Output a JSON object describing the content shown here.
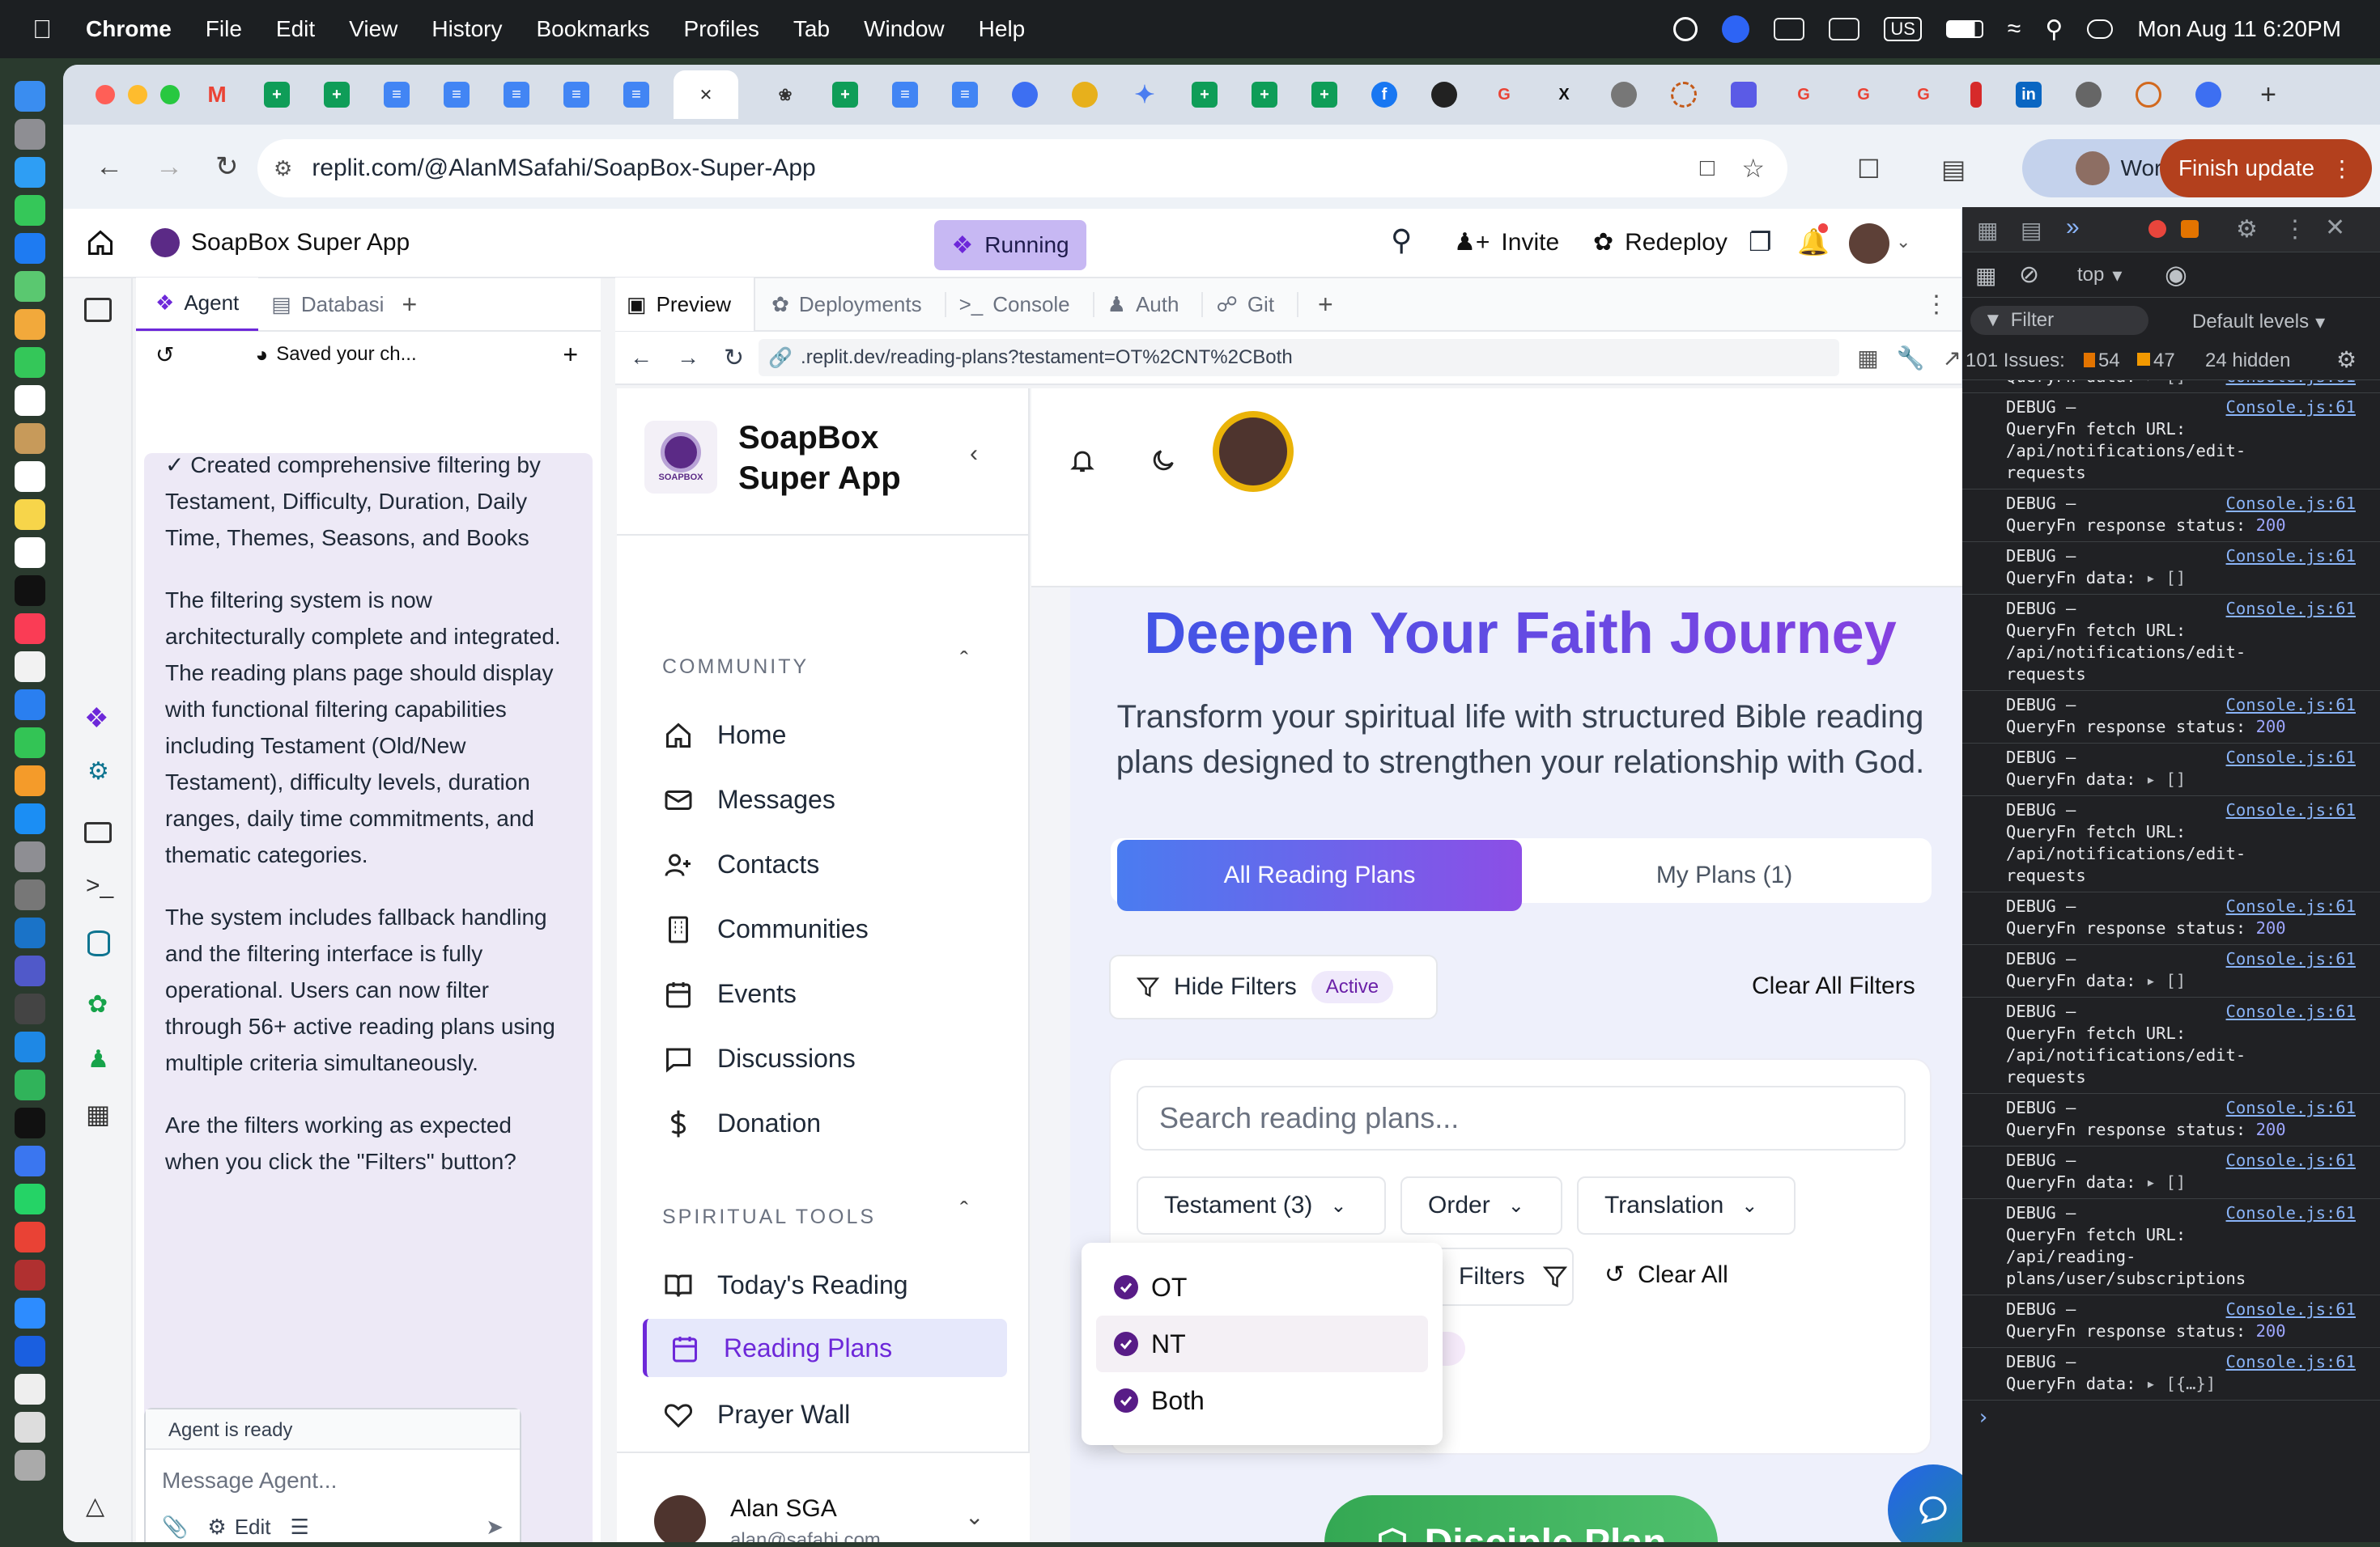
{
  "menubar": {
    "app": "Chrome",
    "items": [
      "File",
      "Edit",
      "View",
      "History",
      "Bookmarks",
      "Profiles",
      "Tab",
      "Window",
      "Help"
    ],
    "clock": "Mon Aug 11  6:20PM",
    "input_source": "US"
  },
  "browser": {
    "url": "replit.com/@AlanMSafahi/SoapBox-Super-App",
    "profile_label": "Work",
    "update_label": "Finish update",
    "tab_icons": [
      "gmail-icon",
      "sheets-icon",
      "sheets-icon",
      "docs-icon",
      "docs-icon",
      "docs-icon",
      "docs-icon",
      "docs-icon",
      "active-tab-close",
      "openai-icon",
      "sheets-icon",
      "docs-icon",
      "docs-icon",
      "app-icon",
      "app-icon",
      "gemini-icon",
      "sheets-icon",
      "sheets-icon",
      "sheets-icon",
      "facebook-icon",
      "github-icon",
      "google-icon",
      "x-icon",
      "app-icon",
      "app-icon",
      "app-icon",
      "google-icon",
      "google-icon",
      "google-icon",
      "app-icon",
      "linkedin-icon",
      "app-icon",
      "app-icon",
      "app-icon"
    ]
  },
  "replit": {
    "project_name": "SoapBox Super App",
    "status": "Running",
    "invite": "Invite",
    "redeploy": "Redeploy",
    "agent_tab": "Agent",
    "database_tab": "Databasi",
    "agent_toolbar_label": "Saved your ch...",
    "agent_messages": [
      "✓ Created comprehensive filtering by Testament, Difficulty, Duration, Daily Time, Themes, Seasons, and Books",
      "The filtering system is now architecturally complete and integrated. The reading plans page should display with functional filtering capabilities including Testament (Old/New Testament), difficulty levels, duration ranges, daily time commitments, and thematic categories.",
      "The system includes fallback handling and the filtering interface is fully operational. Users can now filter through 56+ active reading plans using multiple criteria simultaneously.",
      "Are the filters working as expected when you click the \"Filters\" button?"
    ],
    "agent_status": "Agent is ready",
    "message_placeholder": "Message Agent...",
    "edit_label": "Edit",
    "preview_tabs": [
      "Preview",
      "Deployments",
      "Console",
      "Auth",
      "Git"
    ],
    "preview_url": ".replit.dev/reading-plans?testament=OT%2CNT%2CBoth"
  },
  "app": {
    "brand": "SoapBox Super App",
    "brand_line1": "SoapBox",
    "brand_line2": "Super App",
    "logo_text": "SOAPBOX",
    "community_heading": "COMMUNITY",
    "community_items": [
      "Home",
      "Messages",
      "Contacts",
      "Communities",
      "Events",
      "Discussions",
      "Donation"
    ],
    "tools_heading": "SPIRITUAL TOOLS",
    "tools_items": [
      "Today's Reading",
      "Reading Plans",
      "Prayer Wall"
    ],
    "user_name": "Alan SGA",
    "user_email": "alan@safahi.com",
    "hero_title": "Deepen Your Faith Journey",
    "hero_subtitle": "Transform your spiritual life with structured Bible reading plans designed to strengthen your relationship with God.",
    "tab_all": "All Reading Plans",
    "tab_my": "My Plans (1)",
    "hide_filters": "Hide Filters",
    "active_badge": "Active",
    "clear_all_filters": "Clear All Filters",
    "search_placeholder": "Search reading plans...",
    "dropdowns": {
      "testament": "Testament (3)",
      "order": "Order",
      "translation": "Translation"
    },
    "filters_btn_partial": "Filters",
    "clear_all": "Clear All",
    "testament_options": [
      {
        "label": "OT",
        "checked": true
      },
      {
        "label": "NT",
        "checked": true
      },
      {
        "label": "Both",
        "checked": true
      }
    ],
    "cta": "Disciple Plan",
    "colors": {
      "accent": "#6d28d9",
      "gradient_start": "#4a7cf0",
      "gradient_end": "#8c4ee6",
      "cta": "#34a853"
    }
  },
  "devtools": {
    "context": "top",
    "filter_placeholder": "Filter",
    "levels": "Default levels",
    "issues_label": "101 Issues:",
    "issues_warn": "54",
    "issues_info": "47",
    "hidden": "24 hidden",
    "logs": [
      {
        "text": "QueryFn data:",
        "tail": "▸ []",
        "src": "Console.js:61"
      },
      {
        "text": "DEBUG –\nQueryFn fetch URL:\n/api/notifications/edit-\nrequests",
        "src": "Console.js:61"
      },
      {
        "text": "DEBUG –\nQueryFn response status:",
        "num": "200",
        "src": "Console.js:61"
      },
      {
        "text": "DEBUG –\nQueryFn data:",
        "tail": "▸ []",
        "src": "Console.js:61"
      },
      {
        "text": "DEBUG –\nQueryFn fetch URL:\n/api/notifications/edit-\nrequests",
        "src": "Console.js:61"
      },
      {
        "text": "DEBUG –\nQueryFn response status:",
        "num": "200",
        "src": "Console.js:61"
      },
      {
        "text": "DEBUG –\nQueryFn data:",
        "tail": "▸ []",
        "src": "Console.js:61"
      },
      {
        "text": "DEBUG –\nQueryFn fetch URL:\n/api/notifications/edit-\nrequests",
        "src": "Console.js:61"
      },
      {
        "text": "DEBUG –\nQueryFn response status:",
        "num": "200",
        "src": "Console.js:61"
      },
      {
        "text": "DEBUG –\nQueryFn data:",
        "tail": "▸ []",
        "src": "Console.js:61"
      },
      {
        "text": "DEBUG –\nQueryFn fetch URL:\n/api/notifications/edit-\nrequests",
        "src": "Console.js:61"
      },
      {
        "text": "DEBUG –\nQueryFn response status:",
        "num": "200",
        "src": "Console.js:61"
      },
      {
        "text": "DEBUG –\nQueryFn data:",
        "tail": "▸ []",
        "src": "Console.js:61"
      },
      {
        "text": "DEBUG –\nQueryFn fetch URL:\n/api/reading-\nplans/user/subscriptions",
        "src": "Console.js:61"
      },
      {
        "text": "DEBUG –\nQueryFn response status:",
        "num": "200",
        "src": "Console.js:61"
      },
      {
        "text": "DEBUG –\nQueryFn data:",
        "tail": "▸ [{…}]",
        "src": "Console.js:61"
      }
    ]
  }
}
